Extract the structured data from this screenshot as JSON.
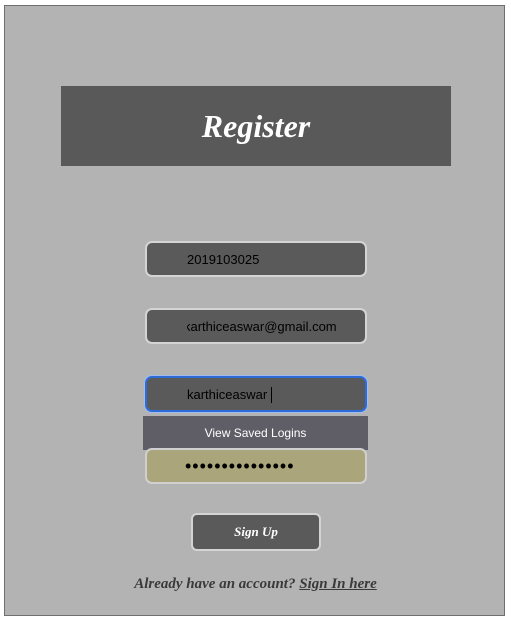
{
  "header": {
    "title": "Register"
  },
  "form": {
    "id_value": "2019103025",
    "email_value": "karthiceaswar@gmail.com",
    "username_value": "karthiceaswar",
    "saved_logins_label": "View Saved Logins",
    "password_value": "•••••••••••••••",
    "submit_label": "Sign Up"
  },
  "footer": {
    "prompt": "Already have an account?",
    "link": "Sign In here"
  },
  "colors": {
    "background": "#b3b3b3",
    "panel": "#5a5a5a",
    "autofill": "#aaa57a",
    "focus": "#2d6bd6"
  }
}
